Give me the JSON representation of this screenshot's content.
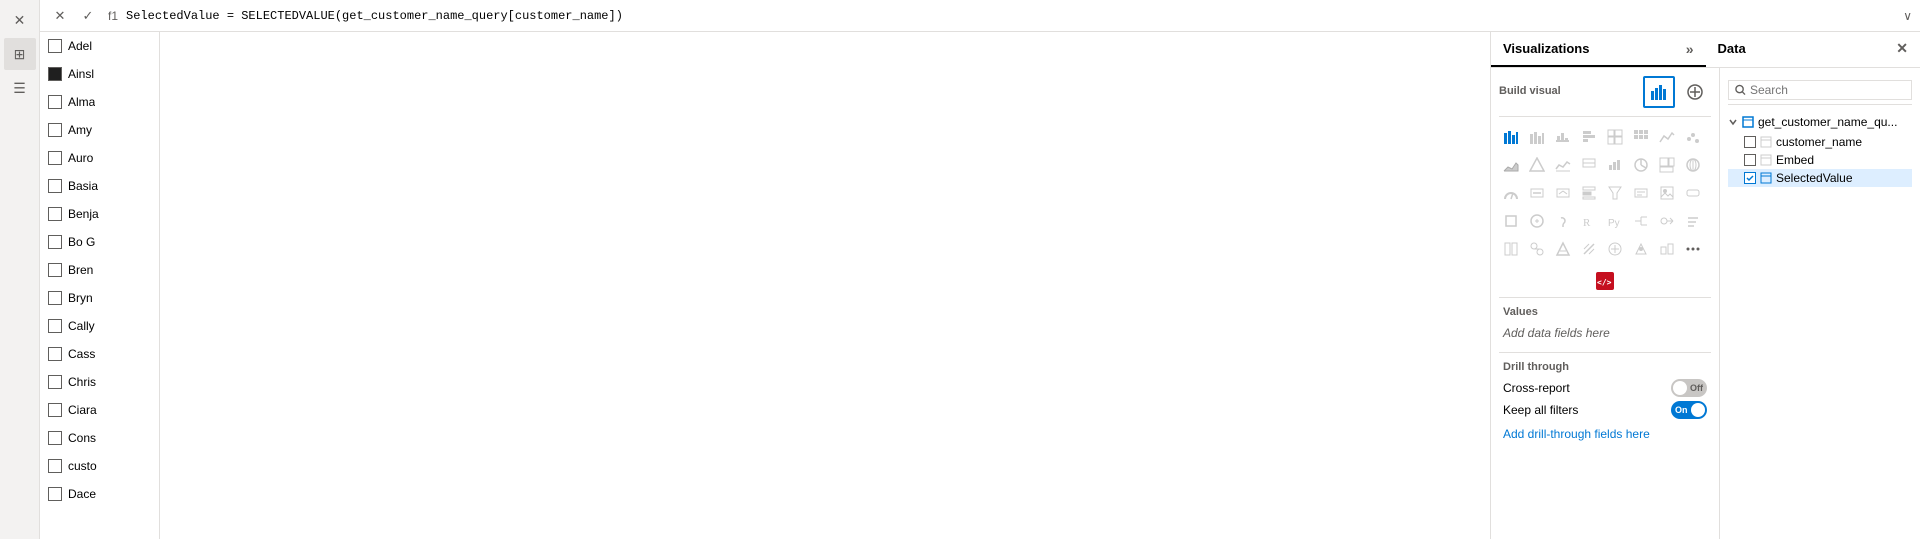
{
  "formula_bar": {
    "close_label": "✕",
    "check_label": "✓",
    "field_name": "f1",
    "formula": "SelectedValue = SELECTEDVALUE(get_customer_name_query[customer_name])",
    "expand_label": "∨"
  },
  "list_items": [
    {
      "id": "adel",
      "label": "Adel",
      "checked": false,
      "filled": false
    },
    {
      "id": "ainsl",
      "label": "Ainsl",
      "checked": false,
      "filled": true
    },
    {
      "id": "alma",
      "label": "Alma",
      "checked": false,
      "filled": false
    },
    {
      "id": "amy",
      "label": "Amy",
      "checked": false,
      "filled": false
    },
    {
      "id": "auro",
      "label": "Auro",
      "checked": false,
      "filled": false
    },
    {
      "id": "basia",
      "label": "Basia",
      "checked": false,
      "filled": false
    },
    {
      "id": "benja",
      "label": "Benja",
      "checked": false,
      "filled": false
    },
    {
      "id": "bo_g",
      "label": "Bo G",
      "checked": false,
      "filled": false
    },
    {
      "id": "bren",
      "label": "Bren",
      "checked": false,
      "filled": false
    },
    {
      "id": "bryn",
      "label": "Bryn",
      "checked": false,
      "filled": false
    },
    {
      "id": "cally",
      "label": "Cally",
      "checked": false,
      "filled": false
    },
    {
      "id": "cass",
      "label": "Cass",
      "checked": false,
      "filled": false
    },
    {
      "id": "chris",
      "label": "Chris",
      "checked": false,
      "filled": false
    },
    {
      "id": "ciara",
      "label": "Ciara",
      "checked": false,
      "filled": false
    },
    {
      "id": "cons",
      "label": "Cons",
      "checked": false,
      "filled": false
    },
    {
      "id": "custo",
      "label": "custo",
      "checked": false,
      "filled": false
    },
    {
      "id": "dace",
      "label": "Dace",
      "checked": false,
      "filled": false
    }
  ],
  "visualizations": {
    "panel_title": "Visualizations",
    "expand_icon": "»",
    "build_visual_label": "Build visual",
    "chart_rows": [
      [
        "⬛",
        "⬚",
        "⬚",
        "⬚",
        "⬚",
        "⬚",
        "⬚",
        "⬚"
      ],
      [
        "⬚",
        "⬚",
        "⬚",
        "⬚",
        "⬚",
        "⬚",
        "⬚",
        "⬚"
      ],
      [
        "⬚",
        "⬚",
        "⬚",
        "⬚",
        "⬚",
        "⬚",
        "⬚",
        "⬚"
      ],
      [
        "⬚",
        "⬚",
        "⬚",
        "⬚",
        "⬚",
        "⬚",
        "⬚",
        "⬚"
      ],
      [
        "⬚",
        "⬚",
        "⬚",
        "⬚",
        "⬚",
        "⬚",
        "⬚",
        "⬚"
      ],
      [
        "⬚",
        "⬚",
        "⬚",
        "⬚",
        "⬚",
        "⬚",
        "⬚",
        "⬚"
      ],
      [
        "⬚",
        "⬚",
        "⬚",
        "⬚",
        "⬚",
        "⬚",
        "⬚",
        "⬚"
      ]
    ],
    "html_icon_label": "HTML",
    "values_label": "Values",
    "add_fields_label": "Add data fields here",
    "drill_label": "Drill through",
    "cross_report_label": "Cross-report",
    "cross_report_state": "off",
    "keep_filters_label": "Keep all filters",
    "keep_filters_state": "on",
    "add_drill_label": "Add drill-through fields here"
  },
  "data_panel": {
    "panel_title": "Data",
    "close_icon": "✕",
    "search_placeholder": "Search",
    "tree_root": "get_customer_name_qu...",
    "items": [
      {
        "label": "customer_name",
        "icon": "🔤",
        "checked": false
      },
      {
        "label": "Embed",
        "icon": "📋",
        "checked": false
      },
      {
        "label": "SelectedValue",
        "icon": "📋",
        "checked": true
      }
    ]
  },
  "left_sidebar": {
    "icons": [
      {
        "name": "close",
        "symbol": "✕"
      },
      {
        "name": "grid",
        "symbol": "⊞"
      },
      {
        "name": "layers",
        "symbol": "⊟"
      }
    ]
  }
}
